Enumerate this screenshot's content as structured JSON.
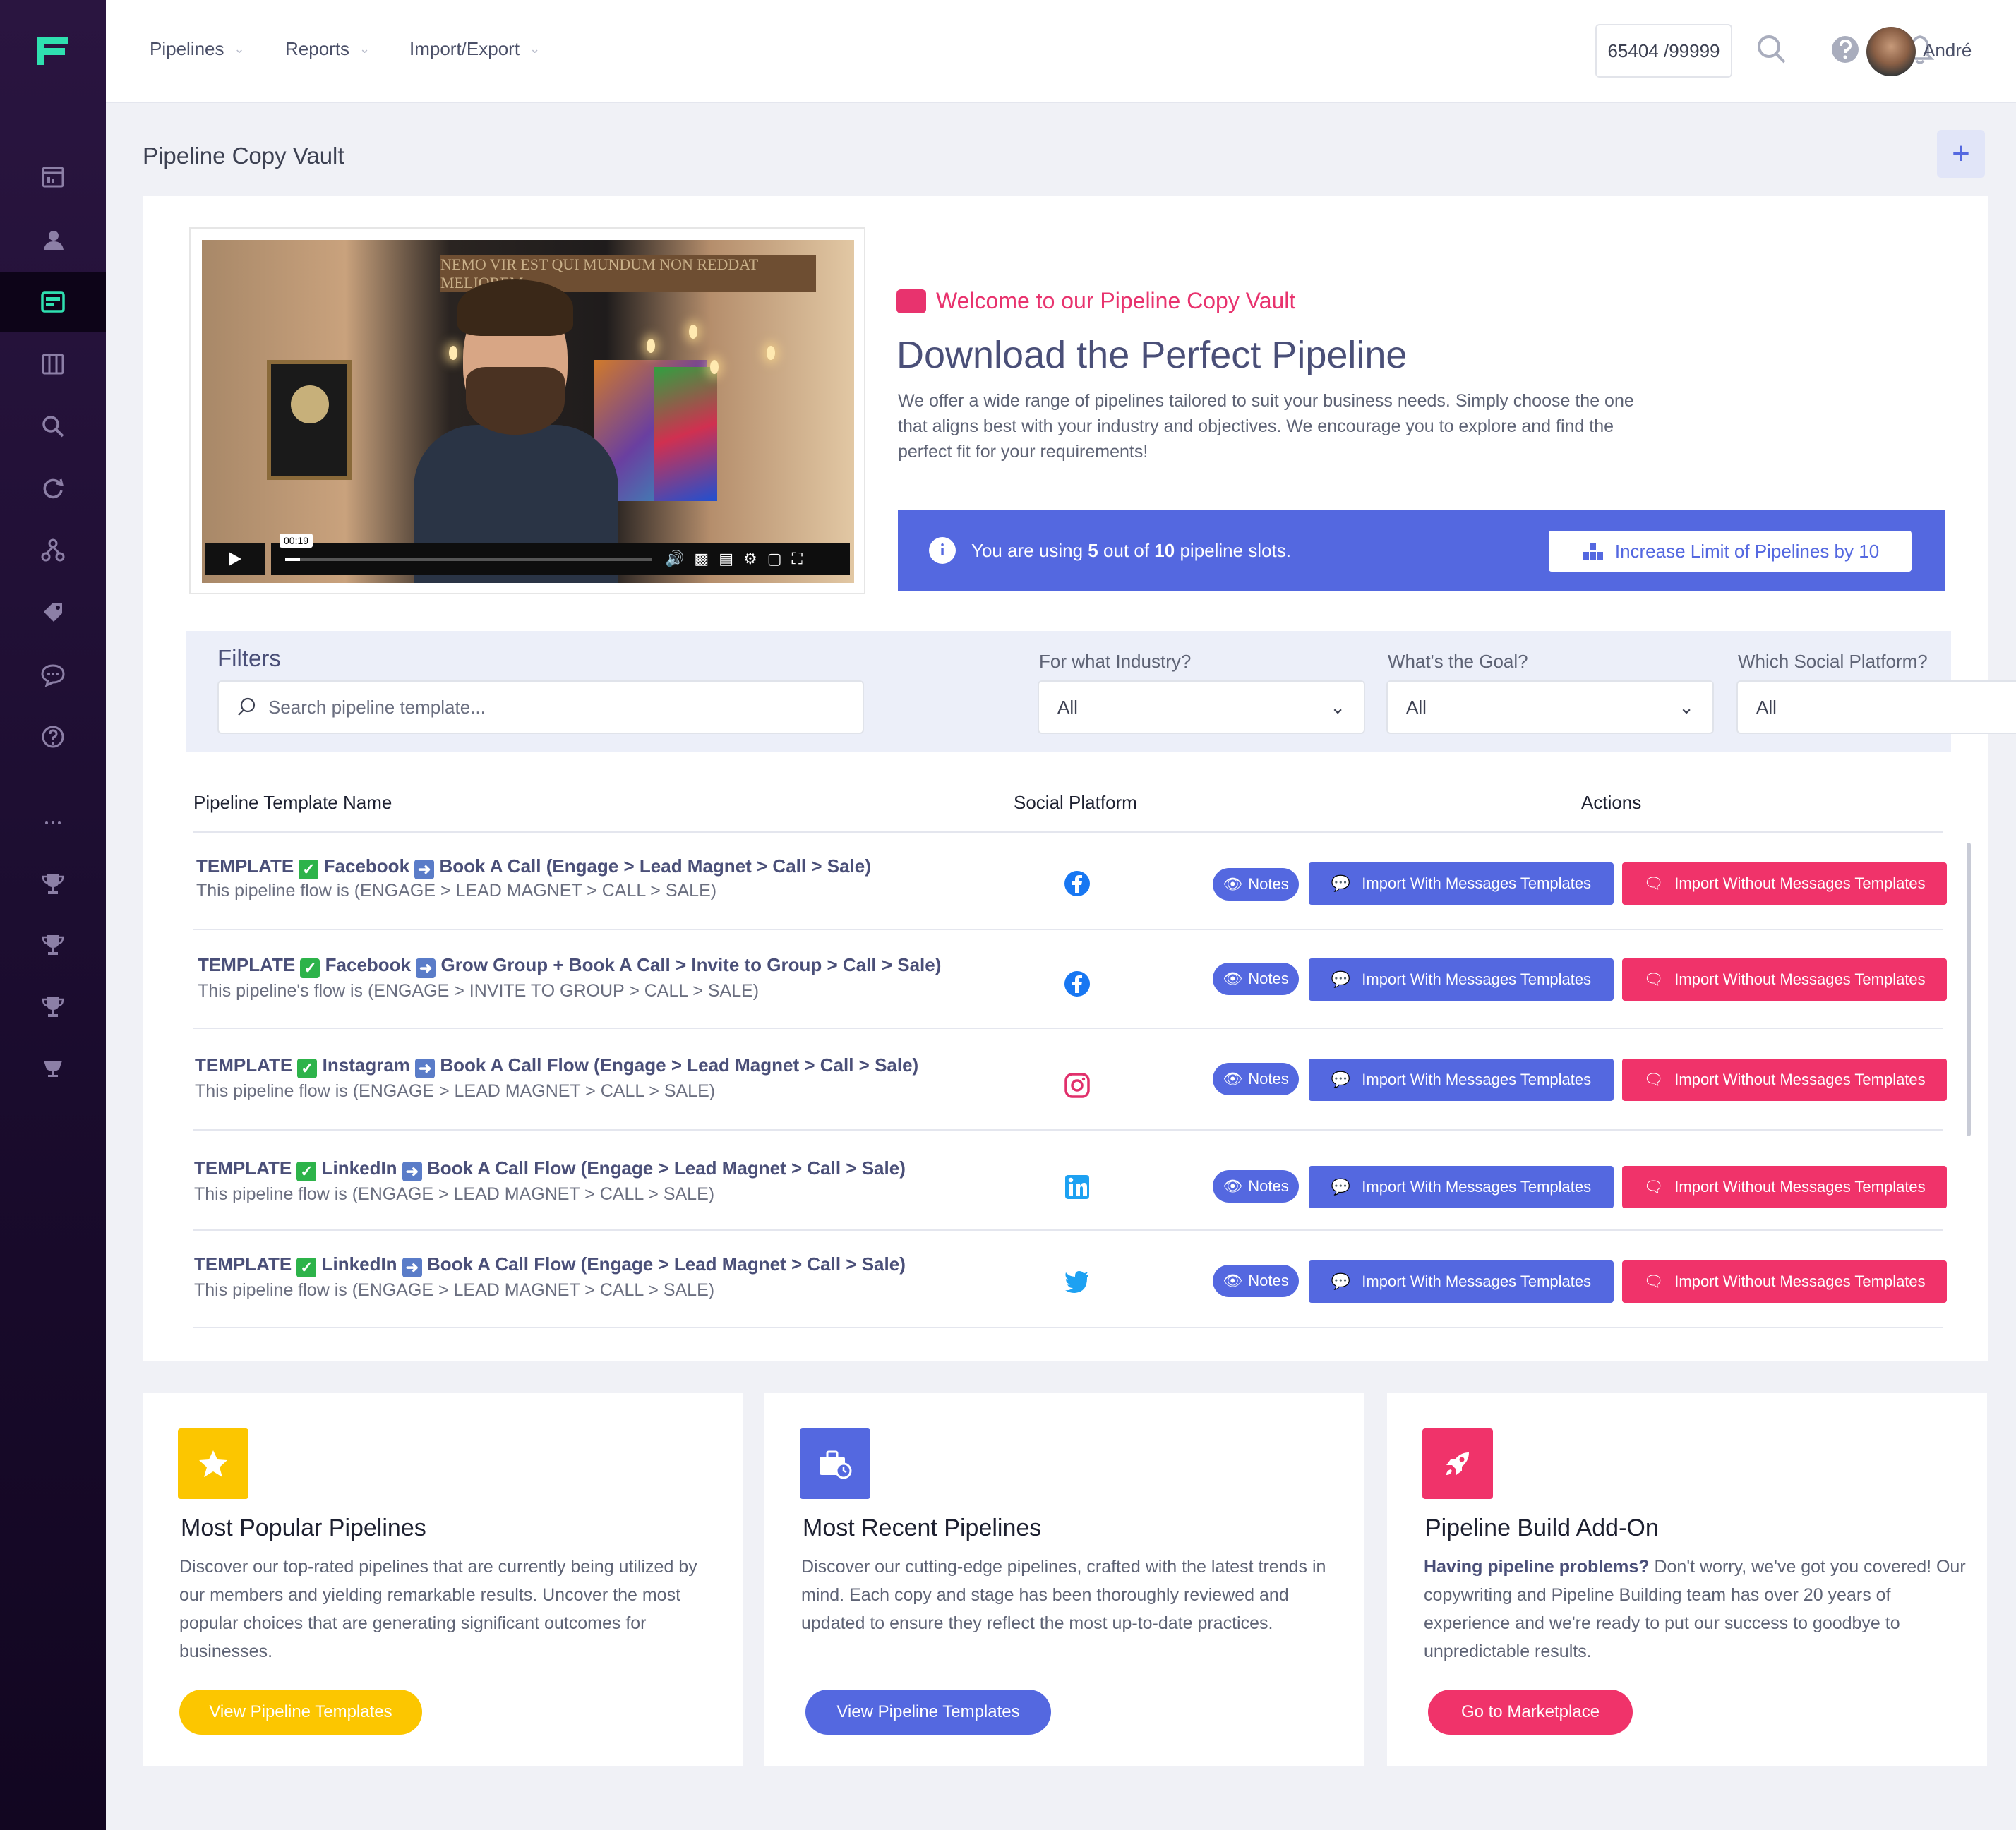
{
  "nav": {
    "items": [
      {
        "label": "Pipelines"
      },
      {
        "label": "Reports"
      },
      {
        "label": "Import/Export"
      }
    ]
  },
  "header": {
    "counter": "65404 /99999",
    "username": "André"
  },
  "page": {
    "title": "Pipeline Copy Vault",
    "add_button": "+"
  },
  "video": {
    "sign_text": "NEMO VIR EST QUI MUNDUM NON REDDAT MELIOREM",
    "time": "00:19",
    "progress_percent": 4
  },
  "hero": {
    "welcome": "Welcome to our Pipeline Copy Vault",
    "headline": "Download the Perfect Pipeline",
    "description": "We offer a wide range of pipelines tailored to suit your business needs. Simply choose the one that aligns best with your industry and objectives. We encourage you to explore and find the perfect fit for your requirements!",
    "slots_prefix": "You are using",
    "slots_used": "5",
    "slots_mid": "out of",
    "slots_total": "10",
    "slots_suffix": "pipeline slots.",
    "increase_button": "Increase Limit of Pipelines by 10"
  },
  "filters": {
    "title": "Filters",
    "search_placeholder": "Search pipeline template...",
    "industry_label": "For what Industry?",
    "industry_value": "All",
    "goal_label": "What's the Goal?",
    "goal_value": "All",
    "platform_label": "Which Social Platform?",
    "platform_value": "All"
  },
  "table": {
    "headers": {
      "name": "Pipeline Template Name",
      "platform": "Social Platform",
      "actions": "Actions"
    },
    "notes_label": "Notes",
    "import_with_label": "Import With Messages Templates",
    "import_without_label": "Import Without Messages Templates",
    "rows": [
      {
        "tag": "TEMPLATE",
        "platform_name": "Facebook",
        "rest": "Book A Call (Engage > Lead Magnet > Call > Sale)",
        "sub": "This pipeline flow is (ENGAGE > LEAD MAGNET > CALL > SALE)",
        "icon": "facebook-icon"
      },
      {
        "tag": "TEMPLATE",
        "platform_name": "Facebook",
        "rest": "Grow Group + Book A Call > Invite to Group > Call > Sale)",
        "sub": "This pipeline's flow is (ENGAGE > INVITE TO GROUP > CALL > SALE)",
        "icon": "facebook-icon"
      },
      {
        "tag": "TEMPLATE",
        "platform_name": "Instagram",
        "rest": "Book A Call Flow (Engage > Lead Magnet > Call > Sale)",
        "sub": "This pipeline flow is (ENGAGE > LEAD MAGNET > CALL > SALE)",
        "icon": "instagram-icon"
      },
      {
        "tag": "TEMPLATE",
        "platform_name": "LinkedIn",
        "rest": "Book A Call Flow (Engage > Lead Magnet > Call > Sale)",
        "sub": "This pipeline flow is (ENGAGE > LEAD MAGNET > CALL > SALE)",
        "icon": "linkedin-icon"
      },
      {
        "tag": "TEMPLATE",
        "platform_name": "LinkedIn",
        "rest": "Book A Call Flow (Engage > Lead Magnet > Call > Sale)",
        "sub": "This pipeline flow is (ENGAGE > LEAD MAGNET > CALL > SALE)",
        "icon": "twitter-icon"
      }
    ]
  },
  "cards": [
    {
      "title": "Most Popular Pipelines",
      "text": "Discover our top-rated pipelines that are currently being utilized by our members and yielding remarkable results. Uncover the most popular choices that are generating significant outcomes for businesses.",
      "button": "View Pipeline Templates",
      "color": "#fcc600"
    },
    {
      "title": "Most Recent Pipelines",
      "text": "Discover our cutting-edge pipelines, crafted with the latest trends in mind. Each copy and stage has been thoroughly reviewed and updated to ensure they reflect the most up-to-date practices.",
      "button": "View Pipeline Templates",
      "color": "#5468e0"
    },
    {
      "title": "Pipeline Build Add-On",
      "text_bold": "Having pipeline problems?",
      "text": "Don't worry, we've got you covered! Our copywriting and Pipeline Building team has over 20 years of experience and we're ready to put our success to goodbye to unpredictable results.",
      "button": "Go to Marketplace",
      "color": "#f0336a"
    }
  ],
  "colors": {
    "accent": "#5468e0",
    "danger": "#f0336a",
    "warning": "#fcc600",
    "sidebar": "#1c0d30",
    "logo": "#2fe0b0"
  }
}
